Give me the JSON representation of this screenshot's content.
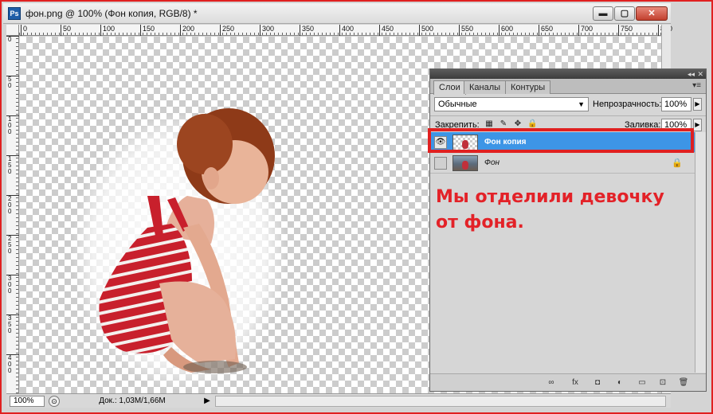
{
  "window": {
    "title": "фон.png @ 100% (Фон копия, RGB/8) *",
    "app_icon": "Ps",
    "min_glyph": "▬",
    "max_glyph": "▢",
    "close_glyph": "✕"
  },
  "ruler": {
    "top_ticks": [
      "0",
      "50",
      "100",
      "150",
      "200",
      "250",
      "300",
      "350",
      "400",
      "450",
      "500",
      "550",
      "600",
      "650",
      "700",
      "750",
      "800"
    ],
    "left_ticks": [
      "0",
      "5\n0",
      "1\n0\n0",
      "1\n5\n0",
      "2\n0\n0",
      "2\n5\n0",
      "3\n0\n0",
      "3\n5\n0",
      "4\n0\n0"
    ]
  },
  "status": {
    "zoom": "100%",
    "doc": "Док.: 1,03M/1,66M",
    "arrow": "▶"
  },
  "panel": {
    "tabs": [
      "Слои",
      "Каналы",
      "Контуры"
    ],
    "active_tab": 0,
    "menu_glyph": "▾≡",
    "collapse_glyph": "◂◂",
    "close_glyph": "✕",
    "blend_mode": "Обычные",
    "opacity_label": "Непрозрачность:",
    "opacity_value": "100%",
    "lock_label": "Закрепить:",
    "fill_label": "Заливка:",
    "fill_value": "100%",
    "layers": [
      {
        "name": "Фон копия",
        "visible": true,
        "selected": true
      },
      {
        "name": "Фон",
        "visible": false,
        "selected": false,
        "locked": true
      }
    ],
    "annotation_line1": "Мы отделили девочку",
    "annotation_line2": "от  фона.",
    "bottom_icons": [
      "∞",
      "fx",
      "◘",
      "◐",
      "▭",
      "⊡",
      "🗑"
    ]
  },
  "colors": {
    "accent": "#e02020",
    "selection": "#3d95e6",
    "annotation": "#e32228"
  }
}
